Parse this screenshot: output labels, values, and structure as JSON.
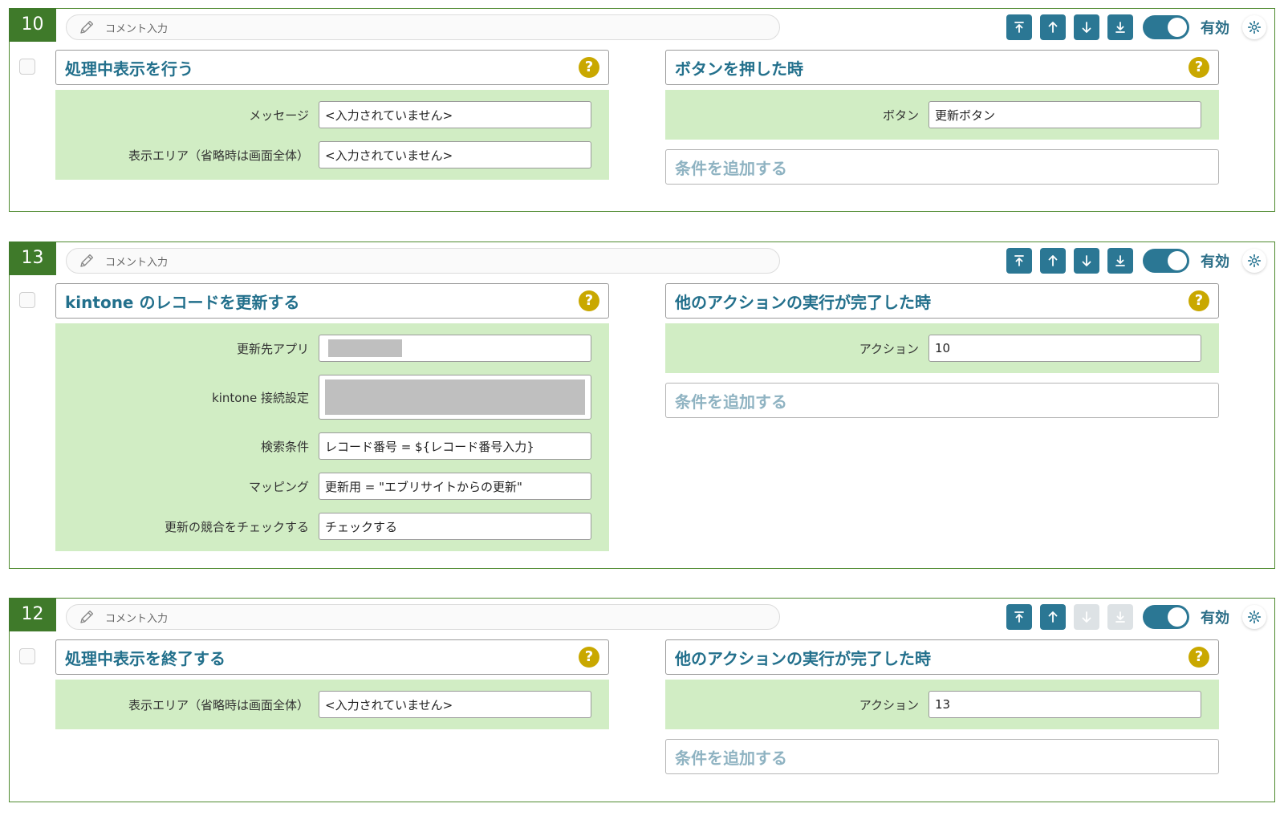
{
  "comment_placeholder": "コメント入力",
  "toggle_label": "有効",
  "add_condition_label": "条件を追加する",
  "cards": [
    {
      "number": "10",
      "action": {
        "title": "処理中表示を行う",
        "fields": [
          {
            "label": "メッセージ",
            "value": "<入力されていません>"
          },
          {
            "label": "表示エリア（省略時は画面全体）",
            "value": "<入力されていません>"
          }
        ]
      },
      "trigger": {
        "title": "ボタンを押した時",
        "fields": [
          {
            "label": "ボタン",
            "value": "更新ボタン"
          }
        ]
      },
      "move_down_enabled": true
    },
    {
      "number": "13",
      "action": {
        "title": "kintone のレコードを更新する",
        "fields": [
          {
            "label": "更新先アプリ",
            "value": "",
            "redacted": "small"
          },
          {
            "label": "kintone 接続設定",
            "value": "",
            "redacted": "full"
          },
          {
            "label": "検索条件",
            "value": "レコード番号 = ${レコード番号入力}"
          },
          {
            "label": "マッピング",
            "value": "更新用 = \"エブリサイトからの更新\""
          },
          {
            "label": "更新の競合をチェックする",
            "value": "チェックする"
          }
        ]
      },
      "trigger": {
        "title": "他のアクションの実行が完了した時",
        "fields": [
          {
            "label": "アクション",
            "value": "10"
          }
        ]
      },
      "move_down_enabled": true
    },
    {
      "number": "12",
      "action": {
        "title": "処理中表示を終了する",
        "fields": [
          {
            "label": "表示エリア（省略時は画面全体）",
            "value": "<入力されていません>"
          }
        ]
      },
      "trigger": {
        "title": "他のアクションの実行が完了した時",
        "fields": [
          {
            "label": "アクション",
            "value": "13"
          }
        ]
      },
      "move_down_enabled": false
    }
  ],
  "colors": {
    "accent": "#2b7794",
    "number_bg": "#3f7a2a",
    "field_bg": "#d1edc4",
    "help": "#c9a800"
  }
}
